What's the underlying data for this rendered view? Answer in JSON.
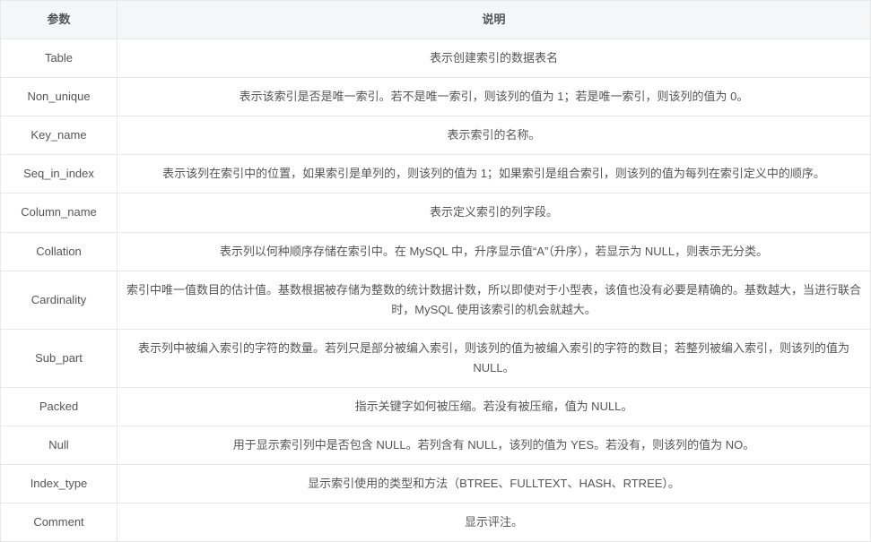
{
  "headers": {
    "param": "参数",
    "desc": "说明"
  },
  "rows": [
    {
      "param": "Table",
      "desc": "表示创建索引的数据表名"
    },
    {
      "param": "Non_unique",
      "desc": "表示该索引是否是唯一索引。若不是唯一索引，则该列的值为 1；若是唯一索引，则该列的值为 0。"
    },
    {
      "param": "Key_name",
      "desc": "表示索引的名称。"
    },
    {
      "param": "Seq_in_index",
      "desc": "表示该列在索引中的位置，如果索引是单列的，则该列的值为 1；如果索引是组合索引，则该列的值为每列在索引定义中的顺序。"
    },
    {
      "param": "Column_name",
      "desc": "表示定义索引的列字段。"
    },
    {
      "param": "Collation",
      "desc": "表示列以何种顺序存储在索引中。在 MySQL 中，升序显示值“A”（升序），若显示为 NULL，则表示无分类。"
    },
    {
      "param": "Cardinality",
      "desc": "索引中唯一值数目的估计值。基数根据被存储为整数的统计数据计数，所以即使对于小型表，该值也没有必要是精确的。基数越大，当进行联合时，MySQL 使用该索引的机会就越大。"
    },
    {
      "param": "Sub_part",
      "desc": "表示列中被编入索引的字符的数量。若列只是部分被编入索引，则该列的值为被编入索引的字符的数目；若整列被编入索引，则该列的值为 NULL。"
    },
    {
      "param": "Packed",
      "desc": "指示关键字如何被压缩。若没有被压缩，值为 NULL。"
    },
    {
      "param": "Null",
      "desc": "用于显示索引列中是否包含 NULL。若列含有 NULL，该列的值为 YES。若没有，则该列的值为 NO。"
    },
    {
      "param": "Index_type",
      "desc": "显示索引使用的类型和方法（BTREE、FULLTEXT、HASH、RTREE）。"
    },
    {
      "param": "Comment",
      "desc": "显示评注。"
    }
  ]
}
